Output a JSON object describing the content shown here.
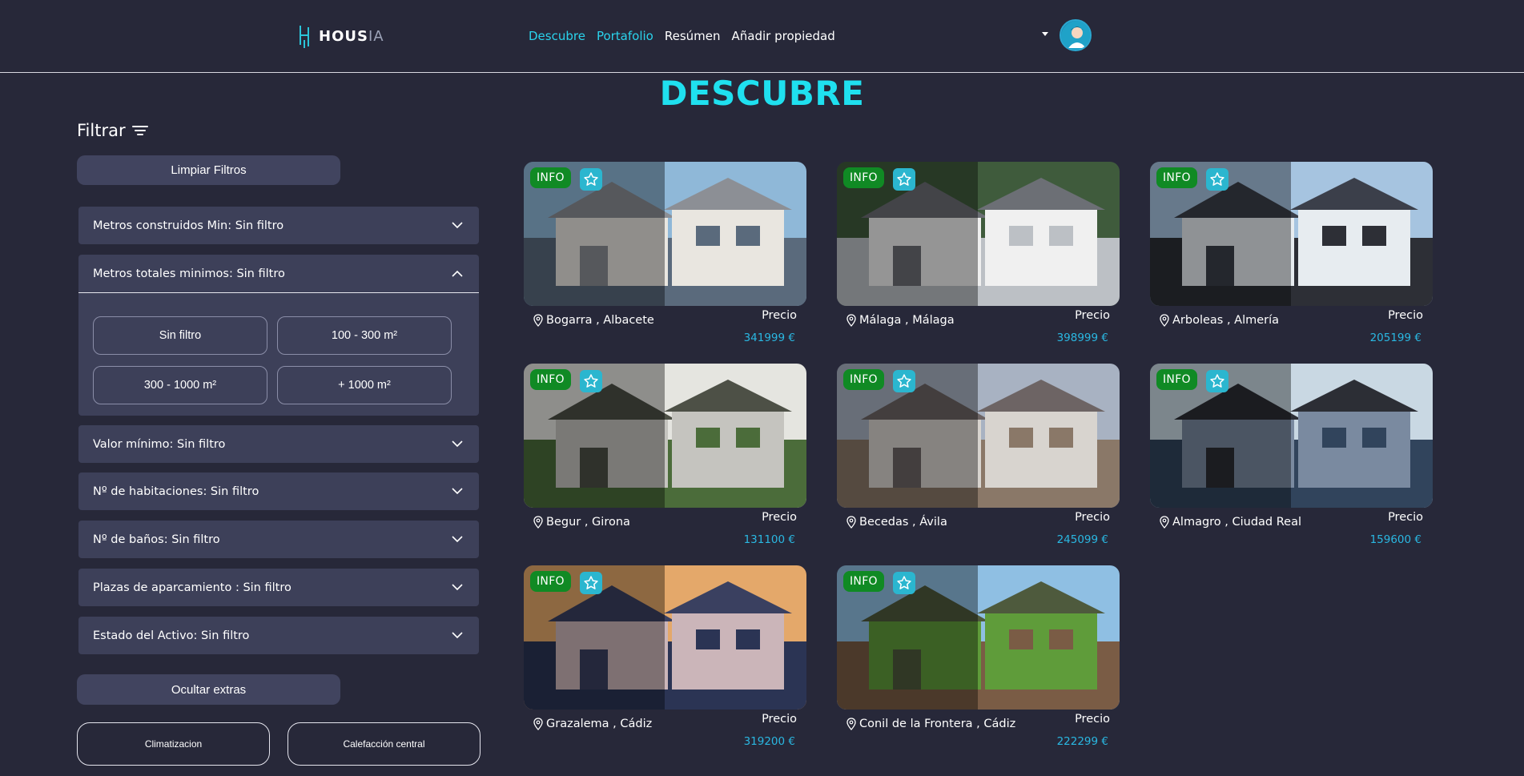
{
  "header": {
    "logo_text": "HOUS",
    "logo_suffix": "IA",
    "nav": [
      {
        "label": "Descubre",
        "active": true
      },
      {
        "label": "Portafolio",
        "active": true
      },
      {
        "label": "Resúmen",
        "active": false
      },
      {
        "label": "Añadir propiedad",
        "active": false
      }
    ]
  },
  "page_title": "DESCUBRE",
  "sidebar": {
    "filter_label": "Filtrar",
    "clear_filters": "Limpiar Filtros",
    "filters": [
      {
        "label": "Metros construidos Min: Sin filtro",
        "expanded": false
      },
      {
        "label": "Metros totales minimos: Sin filtro",
        "expanded": true,
        "options": [
          "Sin filtro",
          "100 - 300 m²",
          "300 - 1000 m²",
          "+ 1000 m²"
        ]
      },
      {
        "label": "Valor mínimo: Sin filtro",
        "expanded": false
      },
      {
        "label": "Nº de habitaciones: Sin filtro",
        "expanded": false
      },
      {
        "label": "Nº de baños: Sin filtro",
        "expanded": false
      },
      {
        "label": "Plazas de aparcamiento : Sin filtro",
        "expanded": false
      },
      {
        "label": "Estado del Activo: Sin filtro",
        "expanded": false
      }
    ],
    "hide_extras": "Ocultar extras",
    "extras": [
      "Climatizacion",
      "Calefacción central"
    ]
  },
  "cards": [
    {
      "location": "Bogarra , Albacete",
      "price_label": "Precio",
      "price": "341999 €",
      "badge": "INFO",
      "palette": [
        "#8c8f95",
        "#e9e6e0",
        "#5a6a7c",
        "#8fb8d8"
      ]
    },
    {
      "location": "Málaga , Málaga",
      "price_label": "Precio",
      "price": "398999 €",
      "badge": "INFO",
      "palette": [
        "#6c6f75",
        "#f0f0f0",
        "#bcc0c5",
        "#3f5b3c"
      ]
    },
    {
      "location": "Arboleas , Almería",
      "price_label": "Precio",
      "price": "205199 €",
      "badge": "INFO",
      "palette": [
        "#3b3f4a",
        "#e7ecf0",
        "#2d2f36",
        "#a6c4e0"
      ]
    },
    {
      "location": "Begur , Girona",
      "price_label": "Precio",
      "price": "131100 €",
      "badge": "INFO",
      "palette": [
        "#4d5046",
        "#c5c4bf",
        "#4b6c3a",
        "#e5e5e0"
      ]
    },
    {
      "location": "Becedas , Ávila",
      "price_label": "Precio",
      "price": "245099 €",
      "badge": "INFO",
      "palette": [
        "#6d6464",
        "#d8d4cf",
        "#8a7868",
        "#a8b2c2"
      ]
    },
    {
      "location": "Almagro , Ciudad Real",
      "price_label": "Precio",
      "price": "159600 €",
      "badge": "INFO",
      "palette": [
        "#2c2e35",
        "#7a8aa0",
        "#31445c",
        "#c9d8e3"
      ]
    },
    {
      "location": "Grazalema , Cádiz",
      "price_label": "Precio",
      "price": "319200 €",
      "badge": "INFO",
      "palette": [
        "#3a4060",
        "#cbb5b9",
        "#2b3454",
        "#e4a86a"
      ]
    },
    {
      "location": "Conil de la Frontera , Cádiz",
      "price_label": "Precio",
      "price": "222299 €",
      "badge": "INFO",
      "palette": [
        "#4e5a3d",
        "#5f9c3a",
        "#7a5c45",
        "#8fbfe3"
      ]
    }
  ]
}
